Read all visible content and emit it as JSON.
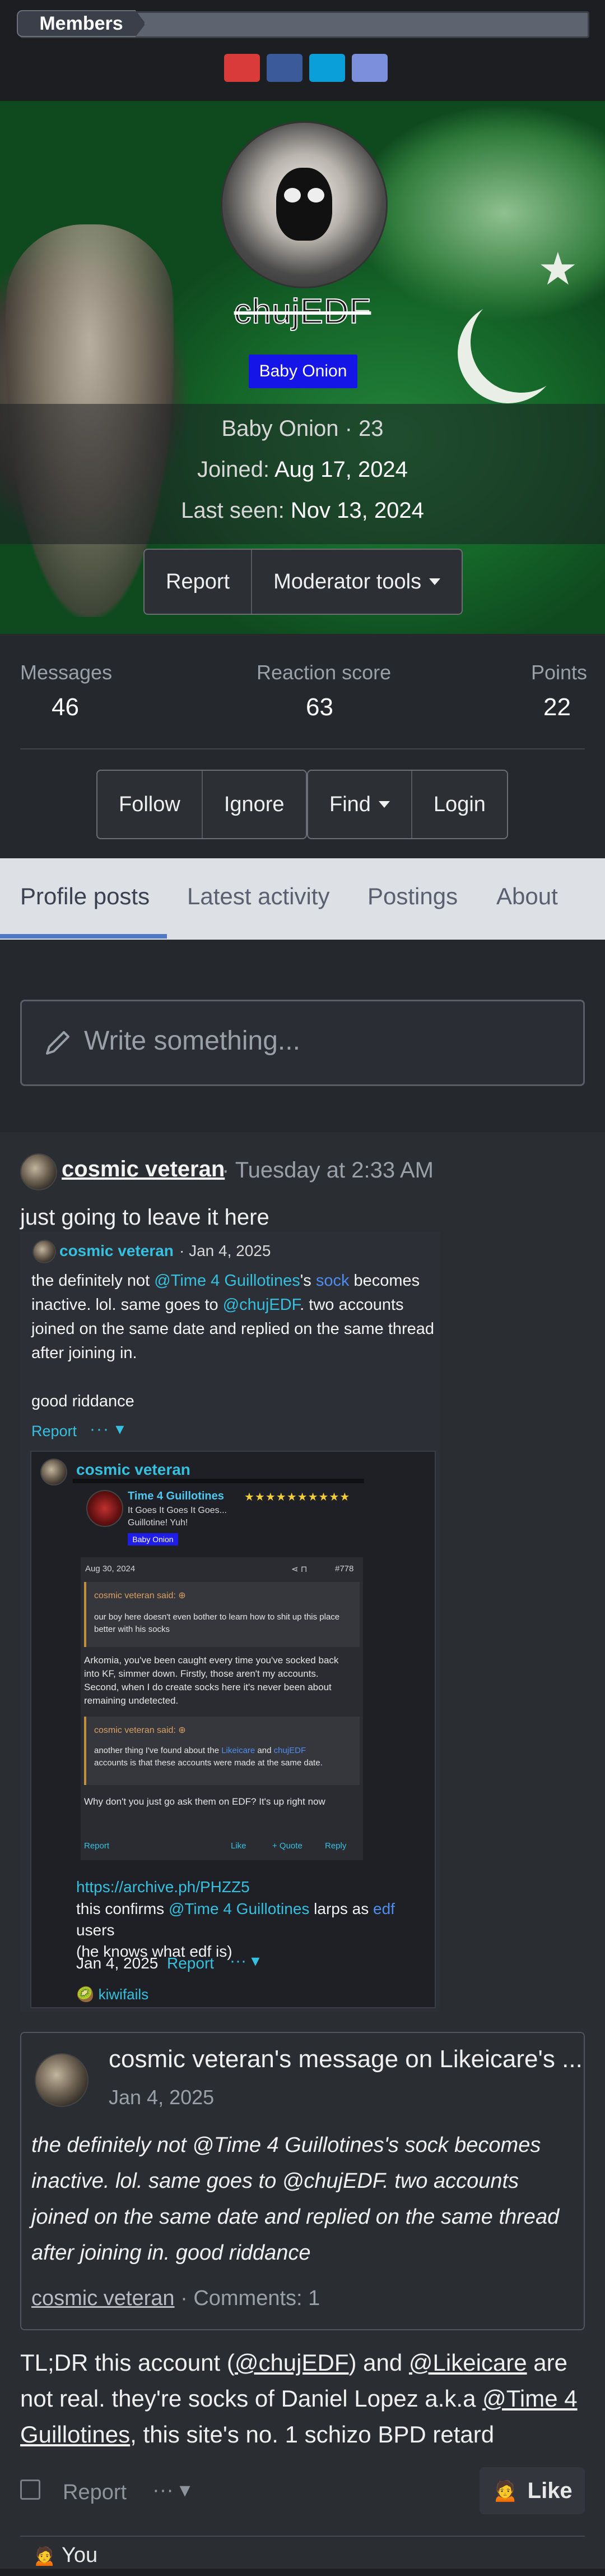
{
  "breadcrumb": {
    "label": "Members"
  },
  "share": {
    "colors": [
      "#d93a3a",
      "#3b5a99",
      "#0a9fd9",
      "#7b8fdc"
    ],
    "icons": [
      "share-reddit-icon",
      "share-facebook-icon",
      "share-twitter-icon",
      "share-email-icon"
    ]
  },
  "profile": {
    "username": "chujEDF",
    "banner": "Baby Onion",
    "title_line": "Baby Onion · 23",
    "joined_label": "Joined:",
    "joined_value": "Aug 17, 2024",
    "last_seen_label": "Last seen:",
    "last_seen_value": "Nov 13, 2024",
    "report_label": "Report",
    "mod_tools_label": "Moderator tools"
  },
  "stats": {
    "messages_label": "Messages",
    "messages": "46",
    "reaction_label": "Reaction score",
    "reaction": "63",
    "points_label": "Points",
    "points": "22"
  },
  "actions": {
    "follow": "Follow",
    "ignore": "Ignore",
    "find": "Find",
    "login": "Login"
  },
  "tabs": [
    "Profile posts",
    "Latest activity",
    "Postings",
    "About"
  ],
  "composer": {
    "placeholder": "Write something..."
  },
  "post": {
    "author": "cosmic veteran",
    "time": "· Tuesday at 2:33 AM",
    "intro": "just going to leave it here",
    "embed": {
      "author": "cosmic veteran",
      "date": "· Jan 4, 2025",
      "text_1": "the definitely not ",
      "mention_1": "@Time 4 Guillotines",
      "text_2": "'s ",
      "sock": "sock",
      "text_3": " becomes inactive. lol. same goes to ",
      "mention_2": "@chujEDF",
      "text_4": ". two accounts joined on the same date and replied on the same thread after joining in.",
      "text_5": "good riddance",
      "report": "Report",
      "dots": "···",
      "nested": {
        "author": "cosmic veteran",
        "quoted_user": "Time 4 Guillotines",
        "quoted_sub_1": "It Goes It Goes It Goes...",
        "quoted_sub_2": "Guillotine! Yuh!",
        "quoted_badge": "Baby Onion",
        "stars": "★★★★★★★★★★",
        "inner_date": "Aug 30, 2024",
        "inner_num": "#778",
        "inner_said_1": "cosmic veteran said: ⊕",
        "inner_quote_1": "our boy here doesn't even bother to learn how to shit up this place better with his socks",
        "inner_reply_1": "Arkomia, you've been caught every time you've socked back into KF, simmer down. Firstly, those aren't my accounts. Second, when I do create socks here it's never been about remaining undetected.",
        "inner_said_2": "cosmic veteran said: ⊕",
        "inner_quote_2_a": "another thing I've found about the ",
        "inner_quote_2_b": "Likeicare",
        "inner_quote_2_c": " and ",
        "inner_quote_2_d": "chujEDF",
        "inner_quote_2_e": " accounts is that these accounts were made at the same date.",
        "inner_reply_2": "Why don't you just go ask them on EDF? It's up right now",
        "inner_report": "Report",
        "inner_like": "Like",
        "inner_quote": "+ Quote",
        "inner_reply": "Reply",
        "link": "https://archive.ph/PHZZ5",
        "text_a": "this confirms ",
        "mention": "@Time 4 Guillotines",
        "text_b": " larps as ",
        "edf": "edf",
        "text_c": " users",
        "text_d": "(he knows what edf is)",
        "date": "Jan 4, 2025",
        "report": "Report",
        "dots": "···",
        "kiwi": "kiwifails"
      }
    },
    "card": {
      "title": "cosmic veteran's message on Likeicare's ...",
      "date": "Jan 4, 2025",
      "text": "the definitely not @Time 4 Guillotines's sock becomes inactive. lol. same goes to @chujEDF. two accounts joined on the same date and replied on the same thread after joining in. good riddance",
      "author": "cosmic veteran",
      "comments": "· Comments: 1"
    },
    "tldr_1": "TL;DR this account (",
    "tldr_m1": "@chujEDF",
    "tldr_2": ") and ",
    "tldr_m2": "@Likeicare",
    "tldr_3": " are not real. they're socks of Daniel Lopez a.k.a ",
    "tldr_m3": "@Time 4 Guillotines",
    "tldr_4": ", this site's no. 1 schizo BPD retard",
    "report": "Report",
    "dots": "···",
    "like": "Like",
    "you": "You"
  }
}
